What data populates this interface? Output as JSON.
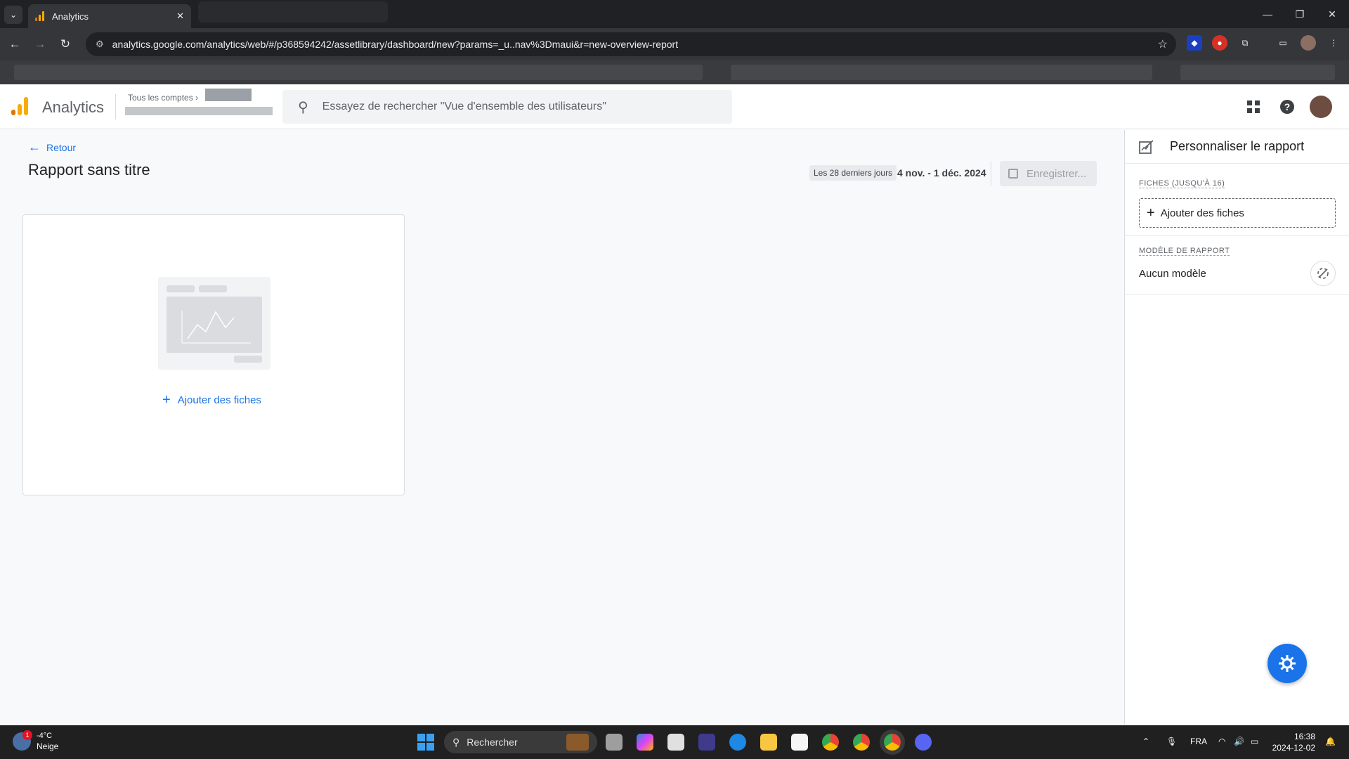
{
  "browser": {
    "tab_title": "Analytics",
    "tab_close": "✕",
    "url": "analytics.google.com/analytics/web/#/p368594242/assetlibrary/dashboard/new?params=_u..nav%3Dmaui&r=new-overview-report",
    "window_controls": [
      "—",
      "❐",
      "✕"
    ]
  },
  "ga_header": {
    "brand": "Analytics",
    "account_label": "Tous les comptes",
    "search_placeholder": "Essayez de rechercher \"Vue d'ensemble des utilisateurs\""
  },
  "main": {
    "back_label": "Retour",
    "title": "Rapport sans titre",
    "date_chip": "Les 28 derniers jours",
    "date_range": "4 nov. - 1 déc. 2024",
    "save_label": "Enregistrer...",
    "add_cards_label": "Ajouter des fiches"
  },
  "panel": {
    "title": "Personnaliser le rapport",
    "cards_section": "FICHES (JUSQU'À 16)",
    "add_cards_label": "Ajouter des fiches",
    "template_section": "MODÈLE DE RAPPORT",
    "template_value": "Aucun modèle"
  },
  "taskbar": {
    "weather_temp": "-4°C",
    "weather_desc": "Neige",
    "weather_badge": "1",
    "search_label": "Rechercher",
    "language": "FRA",
    "time": "16:38",
    "date": "2024-12-02"
  },
  "colors": {
    "accent": "#1a73e8",
    "ga_orange": "#f9ab00",
    "ga_dark_orange": "#e37400"
  }
}
